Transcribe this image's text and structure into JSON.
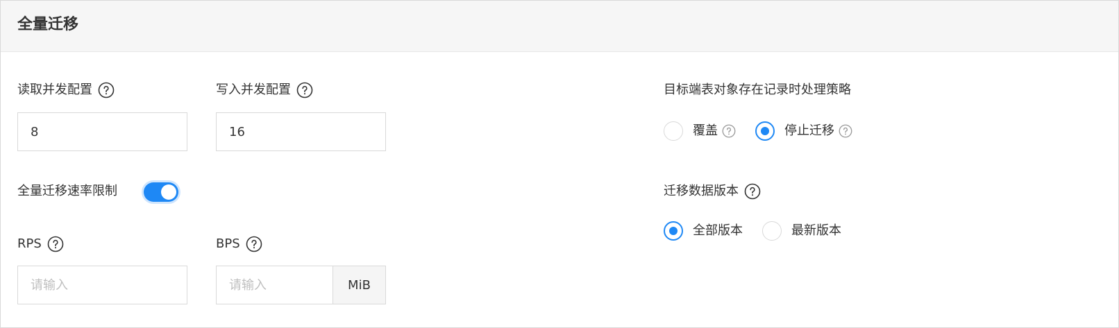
{
  "panel": {
    "title": "全量迁移"
  },
  "read_concurrency": {
    "label": "读取并发配置",
    "value": "8"
  },
  "write_concurrency": {
    "label": "写入并发配置",
    "value": "16"
  },
  "rate_limit": {
    "label": "全量迁移速率限制",
    "enabled": true
  },
  "rps": {
    "label": "RPS",
    "placeholder": "请输入",
    "value": ""
  },
  "bps": {
    "label": "BPS",
    "placeholder": "请输入",
    "value": "",
    "unit": "MiB"
  },
  "conflict_policy": {
    "label": "目标端表对象存在记录时处理策略",
    "options": [
      {
        "label": "覆盖",
        "checked": false
      },
      {
        "label": "停止迁移",
        "checked": true
      }
    ]
  },
  "data_version": {
    "label": "迁移数据版本",
    "options": [
      {
        "label": "全部版本",
        "checked": true
      },
      {
        "label": "最新版本",
        "checked": false
      }
    ]
  },
  "colors": {
    "accent": "#1e88f5",
    "border": "#d9d9d9",
    "header_bg": "#f6f6f6"
  },
  "icons": {
    "help": "question-circle-icon"
  }
}
